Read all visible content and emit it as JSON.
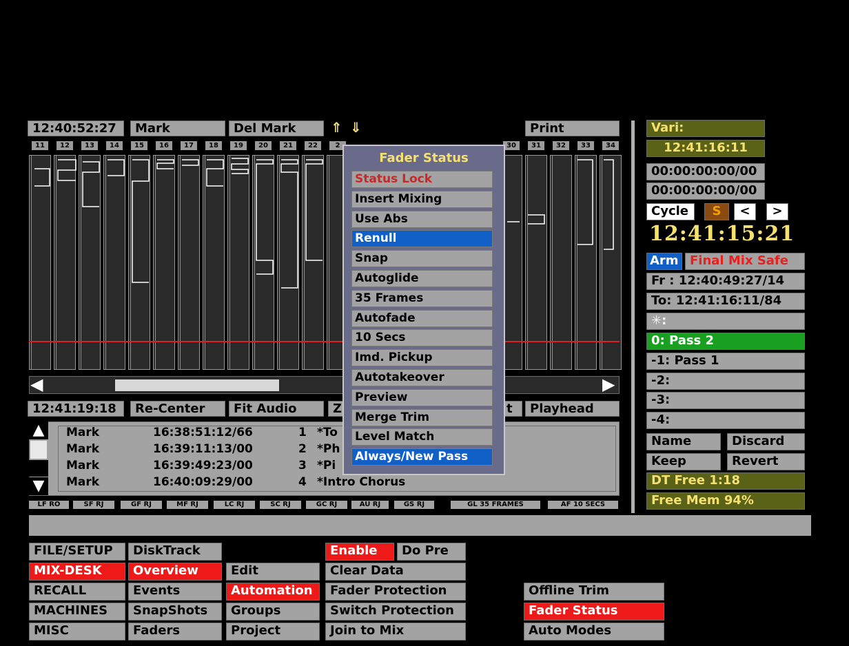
{
  "timeline": {
    "cursor_time": "12:40:52:27",
    "mark_label": "Mark",
    "del_mark_label": "Del Mark",
    "up_icon": "up-arrow-icon",
    "down_icon": "down-arrow-icon",
    "print_label": "Print",
    "channels": [
      "11",
      "12",
      "13",
      "14",
      "15",
      "16",
      "17",
      "18",
      "19",
      "20",
      "21",
      "22",
      "2",
      "30",
      "31",
      "32",
      "33",
      "34"
    ],
    "bottom_time": "12:41:19:18",
    "recenter_label": "Re-Center",
    "fit_audio_label": "Fit Audio",
    "z_label": "Z",
    "t_label": "t",
    "playhead_label": "Playhead"
  },
  "events": {
    "rows": [
      {
        "type": "Mark",
        "time": "16:38:51:12/66",
        "num": "1",
        "name": "*To"
      },
      {
        "type": "Mark",
        "time": "16:39:11:13/00",
        "num": "2",
        "name": "*Ph"
      },
      {
        "type": "Mark",
        "time": "16:39:49:23/00",
        "num": "3",
        "name": "*Pi"
      },
      {
        "type": "Mark",
        "time": "16:40:09:29/00",
        "num": "4",
        "name": "*Intro  Chorus"
      }
    ]
  },
  "status_strip": [
    "LF RO",
    "SF RJ",
    "GF RJ",
    "MF RJ",
    "LC RJ",
    "SC RJ",
    "GC RJ",
    "AU RJ",
    "GS RJ",
    "GL 35 FRAMES",
    "AF 10 SECS"
  ],
  "popup": {
    "title": "Fader  Status",
    "items": [
      "Status  Lock",
      "Insert  Mixing",
      "Use  Abs",
      "Renull",
      "Snap",
      "Autoglide",
      "35  Frames",
      "Autofade",
      "10  Secs",
      "Imd.  Pickup",
      "Autotakeover",
      "Preview",
      "Merge  Trim",
      "Level  Match",
      "Always/New  Pass"
    ]
  },
  "right_panel": {
    "vari_label": "Vari:",
    "vari_time": "12:41:16:11",
    "tc1": "00:00:00:00/00",
    "tc2": "00:00:00:00/00",
    "cycle_label": "Cycle",
    "s_label": "S",
    "prev_label": "<",
    "next_label": ">",
    "big_time": "12:41:15:21",
    "arm_label": "Arm",
    "final_mix_label": "Final Mix Safe",
    "from_label": "Fr : 12:40:49:27/14",
    "to_label": "To: 12:41:16:11/84",
    "star_label": "✳:",
    "passes": [
      "0:  Pass  2",
      "-1:  Pass  1",
      "-2:",
      "-3:",
      "-4:"
    ],
    "name_label": "Name",
    "discard_label": "Discard",
    "keep_label": "Keep",
    "revert_label": "Revert",
    "dt_free": "DT  Free   1:18",
    "free_mem": "Free   Mem  94%"
  },
  "menu": {
    "col1": [
      "FILE/SETUP",
      "MIX-DESK",
      "RECALL",
      "MACHINES",
      "MISC"
    ],
    "col2": [
      "DiskTrack",
      "Overview",
      "Events",
      "SnapShots",
      "Faders"
    ],
    "col3": [
      "Edit",
      "Automation",
      "Groups",
      "Project"
    ],
    "col4": [
      "Enable",
      "Do  Pre",
      "Clear  Data",
      "Fader  Protection",
      "Switch  Protection",
      "Join  to  Mix"
    ],
    "col5": [
      "Offline  Trim",
      "Fader  Status",
      "Auto  Modes"
    ]
  },
  "colors": {
    "active_red": "#ee1a1a",
    "select_blue": "#1060c8",
    "olive": "#5a6218",
    "green": "#1aa020",
    "time_yellow": "#f5e070",
    "cyan": "#1cc0c8"
  }
}
